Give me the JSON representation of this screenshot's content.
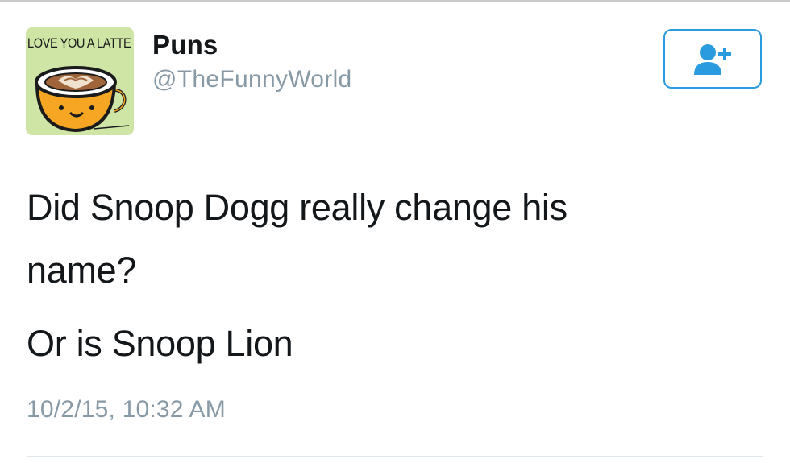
{
  "avatar": {
    "caption": "LOVE YOU A LATTE",
    "background": "#cfe5a6",
    "cup_color": "#f6a623"
  },
  "user": {
    "display_name": "Puns",
    "handle": "@TheFunnyWorld"
  },
  "follow_button": {
    "icon": "add-user-icon",
    "accent": "#2b9be0"
  },
  "tweet": {
    "lines": [
      "Did Snoop Dogg really change his",
      "name?",
      "Or is Snoop Lion"
    ],
    "timestamp": "10/2/15, 10:32 AM"
  }
}
